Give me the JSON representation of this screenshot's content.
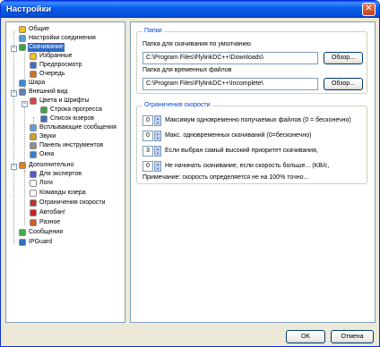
{
  "window": {
    "title": "Настройки",
    "close_glyph": "✕"
  },
  "tree": [
    {
      "label": "Общие",
      "icon": "general-icon",
      "color": "#f0c020"
    },
    {
      "label": "Настройки соединения",
      "icon": "connection-icon",
      "color": "#5a9ad8"
    },
    {
      "label": "Скачивание",
      "icon": "download-icon",
      "color": "#3aa63a",
      "selected": true
    },
    {
      "label": "Избранные",
      "icon": "favorites-icon",
      "color": "#f0c020"
    },
    {
      "label": "Предпросмотр",
      "icon": "preview-icon",
      "color": "#4070c0"
    },
    {
      "label": "Очередь",
      "icon": "queue-icon",
      "color": "#d07020"
    },
    {
      "label": "Шара",
      "icon": "share-icon",
      "color": "#3090e0"
    },
    {
      "label": "Внешний вид",
      "icon": "appearance-icon",
      "color": "#6080b0"
    },
    {
      "label": "Цвета и Шрифты",
      "icon": "colors-fonts-icon",
      "color": "#e04040"
    },
    {
      "label": "Строка прогресса",
      "icon": "progress-bar-icon",
      "color": "#40a040"
    },
    {
      "label": "Список юзеров",
      "icon": "user-list-icon",
      "color": "#4070c0"
    },
    {
      "label": "Всплывающие сообщения",
      "icon": "popup-icon",
      "color": "#60a0e0"
    },
    {
      "label": "Звуки",
      "icon": "sounds-icon",
      "color": "#d0a020"
    },
    {
      "label": "Панель инструментов",
      "icon": "toolbar-icon",
      "color": "#909090"
    },
    {
      "label": "Окна",
      "icon": "windows-icon",
      "color": "#3080d0"
    },
    {
      "label": "Дополнительно",
      "icon": "advanced-icon",
      "color": "#e08020"
    },
    {
      "label": "Для экспертов",
      "icon": "experts-icon",
      "color": "#5060c0"
    },
    {
      "label": "Логи",
      "icon": "logs-icon",
      "color": "#ffffff"
    },
    {
      "label": "Команды юзера",
      "icon": "user-commands-icon",
      "color": "#ffffff"
    },
    {
      "label": "Ограничения скорости",
      "icon": "speed-limit-icon",
      "color": "#c03030"
    },
    {
      "label": "Автобан!",
      "icon": "autoban-icon",
      "color": "#d02020"
    },
    {
      "label": "Разное",
      "icon": "misc-icon",
      "color": "#d06020"
    },
    {
      "label": "Сообщения",
      "icon": "messages-icon",
      "color": "#40b040"
    },
    {
      "label": "IPGuard",
      "icon": "ipguard-icon",
      "color": "#3070c0"
    }
  ],
  "folders": {
    "group_title": "Папки",
    "default_label": "Папка для скачивания по умолчанию",
    "default_value": "C:\\Program Files\\FlylinkDC++\\Downloads\\",
    "temp_label": "Папка для временных файлов",
    "temp_value": "C:\\Program Files\\FlylinkDC++\\Incomplete\\",
    "browse_label": "Обзор..."
  },
  "speed": {
    "group_title": "Ограничения скорости",
    "rows": [
      {
        "value": "0",
        "label": "Максимум одновременно получаемых файлов (0 = бесконечно)"
      },
      {
        "value": "0",
        "label": "Макс. одновременных скачиваний (0=бесконечно)"
      },
      {
        "value": "3",
        "label": "Если выбран самый высокий приоритет скачивания,"
      },
      {
        "value": "0",
        "label": "Не начинать скачивание, если скорость больше... (KB/c,"
      }
    ],
    "note": "Примечание: скорость определяется не на 100% точно..."
  },
  "buttons": {
    "ok": "OK",
    "cancel": "Отмена"
  }
}
